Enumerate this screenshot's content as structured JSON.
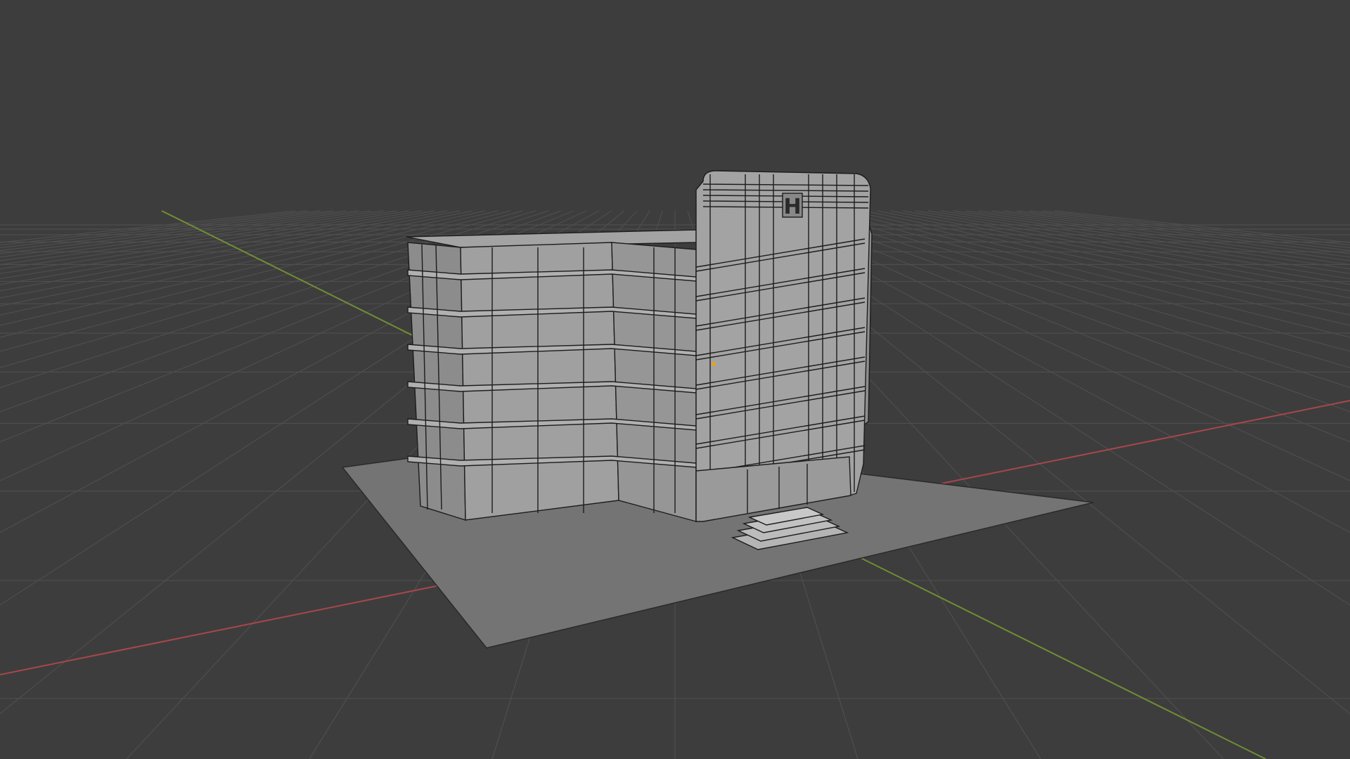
{
  "viewport": {
    "mode": "3d-viewport-solid-wireframe-overlay",
    "background_color": "#3d3d3d",
    "grid_color": "#4d4d4d",
    "x_axis_color": "#b54a4f",
    "y_axis_color": "#7fa03a"
  },
  "scene": {
    "building": {
      "sign_letter": "H",
      "face_color": "#9a9a9a",
      "wire_color": "#1c1c1c"
    },
    "ground_plane": {
      "color": "#7a7a7a"
    },
    "origin_marker": {
      "color": "#e8a020",
      "icon": "object-origin-dot"
    }
  }
}
